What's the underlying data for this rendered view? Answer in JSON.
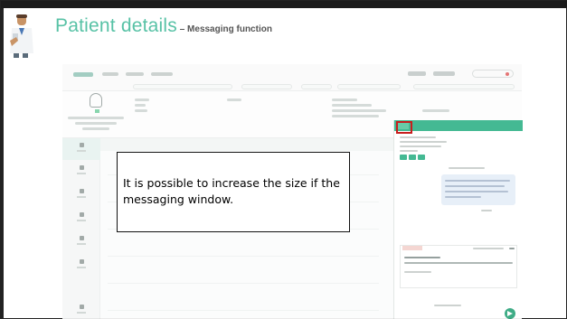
{
  "slide": {
    "title_main": "Patient details",
    "title_separator": " – ",
    "title_sub": "Messaging function"
  },
  "callout": {
    "text": "It is possible to increase the size if the messaging window."
  },
  "colors": {
    "title_green": "#58c2a6",
    "messaging_header_green": "#35b48a",
    "highlight_red": "#c81e1e"
  },
  "icons": {
    "doctor": "doctor-figure-icon",
    "resize": "expand-window-icon",
    "send": "send-icon"
  }
}
